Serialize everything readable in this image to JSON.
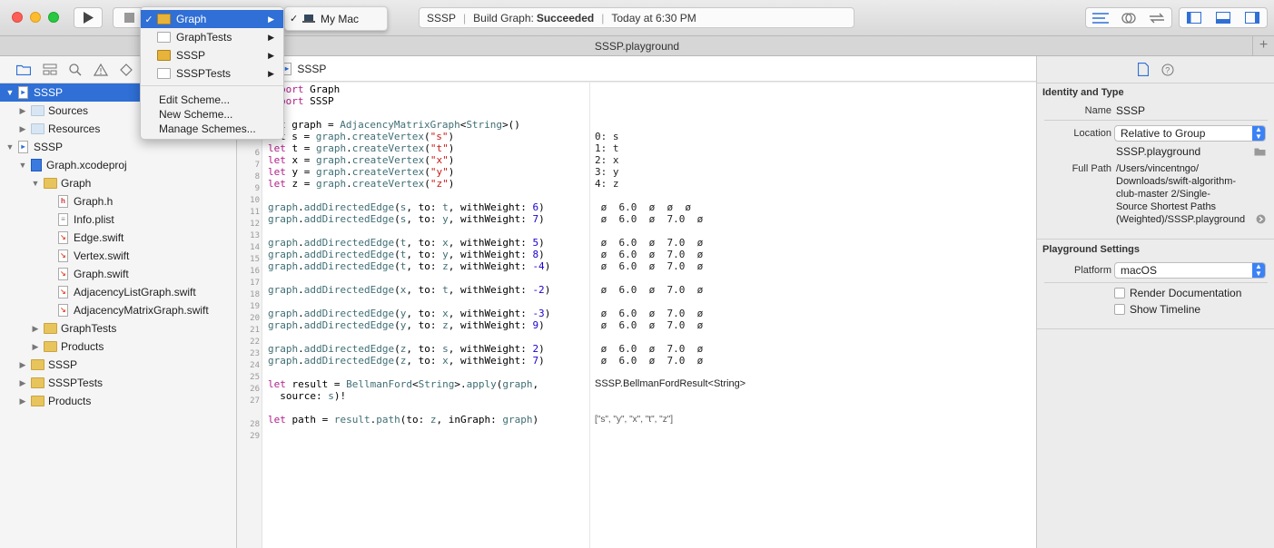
{
  "toolbar": {
    "activity_scheme": "SSSP",
    "activity_status_prefix": "Build Graph: ",
    "activity_status": "Succeeded",
    "activity_time": "Today at 6:30 PM",
    "destination": "My Mac"
  },
  "scheme_menu": {
    "items": [
      {
        "label": "Graph",
        "checked": true,
        "icon": "app-target-icon"
      },
      {
        "label": "GraphTests",
        "checked": false,
        "icon": "test-target-icon"
      },
      {
        "label": "SSSP",
        "checked": false,
        "icon": "app-target-icon"
      },
      {
        "label": "SSSPTests",
        "checked": false,
        "icon": "test-target-icon"
      }
    ],
    "actions": [
      "Edit Scheme...",
      "New Scheme...",
      "Manage Schemes..."
    ]
  },
  "tab": {
    "title": "SSSP.playground"
  },
  "navigator": {
    "items": [
      {
        "label": "SSSP"
      },
      {
        "label": "Sources"
      },
      {
        "label": "Resources"
      },
      {
        "label": "SSSP"
      },
      {
        "label": "Graph.xcodeproj"
      },
      {
        "label": "Graph"
      },
      {
        "label": "Graph.h"
      },
      {
        "label": "Info.plist"
      },
      {
        "label": "Edge.swift"
      },
      {
        "label": "Vertex.swift"
      },
      {
        "label": "Graph.swift"
      },
      {
        "label": "AdjacencyListGraph.swift"
      },
      {
        "label": "AdjacencyMatrixGraph.swift"
      },
      {
        "label": "GraphTests"
      },
      {
        "label": "Products"
      },
      {
        "label": "SSSP"
      },
      {
        "label": "SSSPTests"
      },
      {
        "label": "Products"
      }
    ]
  },
  "editor": {
    "breadcrumb": "SSSP",
    "line_numbers": [
      "6",
      "7",
      "8",
      "9",
      "10",
      "11",
      "12",
      "13",
      "14",
      "15",
      "16",
      "17",
      "18",
      "19",
      "20",
      "21",
      "22",
      "23",
      "24",
      "25",
      "26",
      "27",
      "28",
      "29"
    ],
    "results": {
      "s": "0: s",
      "t": "1: t",
      "x": "2: x",
      "y": "3: y",
      "z": "4: z",
      "r11": " ø  6.0  ø  ø  ø",
      "r12": " ø  6.0  ø  7.0  ø",
      "r14": " ø  6.0  ø  7.0  ø",
      "r15": " ø  6.0  ø  7.0  ø",
      "r16": " ø  6.0  ø  7.0  ø",
      "r18": " ø  6.0  ø  7.0  ø",
      "r20": " ø  6.0  ø  7.0  ø",
      "r21": " ø  6.0  ø  7.0  ø",
      "r23": " ø  6.0  ø  7.0  ø",
      "r24": " ø  6.0  ø  7.0  ø",
      "r26": "SSSP.BellmanFordResult<String>",
      "r28": "[\"s\", \"y\", \"x\", \"t\", \"z\"]"
    }
  },
  "inspector": {
    "identity_title": "Identity and Type",
    "name_label": "Name",
    "name_value": "SSSP",
    "location_label": "Location",
    "location_value": "Relative to Group",
    "location_file": "SSSP.playground",
    "fullpath_label": "Full Path",
    "fullpath_lines": [
      "/Users/vincentngo/",
      "Downloads/swift-algorithm-",
      "club-master 2/Single-",
      "Source Shortest Paths",
      "(Weighted)/SSSP.playground"
    ],
    "playground_title": "Playground Settings",
    "platform_label": "Platform",
    "platform_value": "macOS",
    "render_docs": "Render Documentation",
    "show_timeline": "Show Timeline"
  },
  "colors": {
    "selection": "#2f6fd6",
    "keyword": "#b0208a",
    "string": "#c41a16",
    "number": "#1c00cf"
  }
}
